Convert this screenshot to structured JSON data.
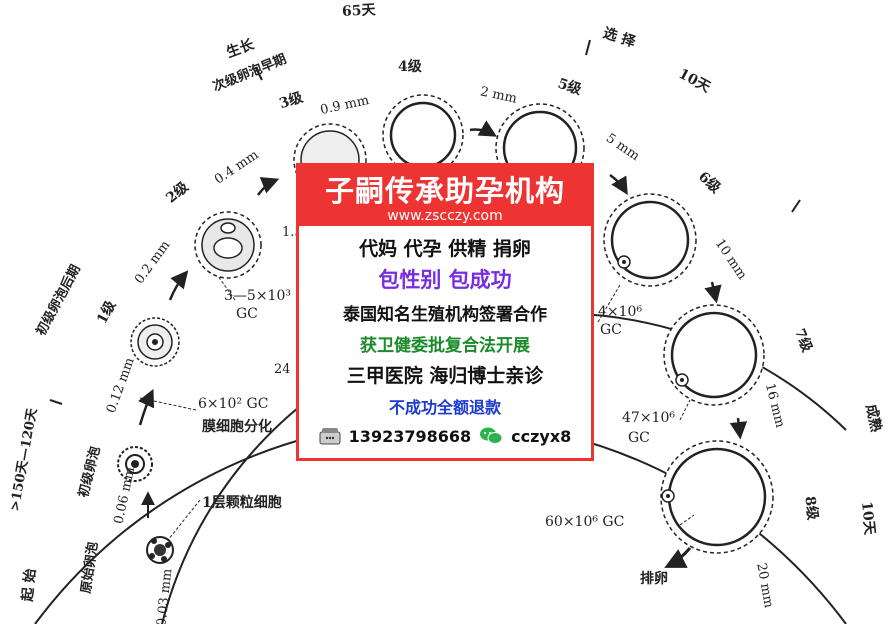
{
  "labels": {
    "days_65": "65天",
    "growth": "生长",
    "secondary_early": "次级卵泡早期",
    "selection": "选 择",
    "days_10_top": "10天",
    "grade_4": "4级",
    "grade_3": "3级",
    "grade_5": "5级",
    "grade_2": "2级",
    "grade_6": "6级",
    "grade_1": "1级",
    "grade_7": "7级",
    "grade_8": "8级",
    "primary_late": "初级卵泡后期",
    "mature": "成熟",
    "days_10_right": "10天",
    "days_150_120": ">150天—120天",
    "primary_follicle": "初级卵泡",
    "primordial_follicle": "原始卵泡",
    "start": "起 始",
    "mm_09": "0.9 mm",
    "mm_2": "2 mm",
    "mm_04": "0.4 mm",
    "mm_5": "5 mm",
    "mm_02": "0.2 mm",
    "mm_10": "10 mm",
    "mm_012": "0.12 mm",
    "mm_16": "16 mm",
    "mm_006": "0.06 mm",
    "mm_20": "20 mm",
    "mm_003": "0.03 mm",
    "gc_3_5": "3—5×10³",
    "gc_3_5_unit": "GC",
    "gc_6e2": "6×10² GC",
    "membrane_diff": "膜细胞分化",
    "one_layer": "1层颗粒细胞",
    "gc_4e6": "4×10⁶",
    "gc_4e6_unit": "GC",
    "gc_47e6": "47×10⁶",
    "gc_47e6_unit": "GC",
    "gc_60e6": "60×10⁶ GC",
    "ovulation": "排卵",
    "partial_15x10": "1.5×10",
    "partial_24_a": "24",
    "partial_24_b": "24"
  },
  "ad": {
    "title": "子嗣传承助孕机构",
    "url": "www.zscczy.com",
    "line1": "代妈 代孕 供精 捐卵",
    "line2": "包性别 包成功",
    "line3": "泰国知名生殖机构签署合作",
    "line4": "获卫健委批复合法开展",
    "line5": "三甲医院 海归博士亲诊",
    "line6": "不成功全额退款",
    "phone": "13923798668",
    "wechat": "cczyx8",
    "colors": {
      "red": "#e33333",
      "purple": "#7a2de0",
      "green": "#1a8a2a",
      "blue": "#1a3ad0"
    }
  }
}
